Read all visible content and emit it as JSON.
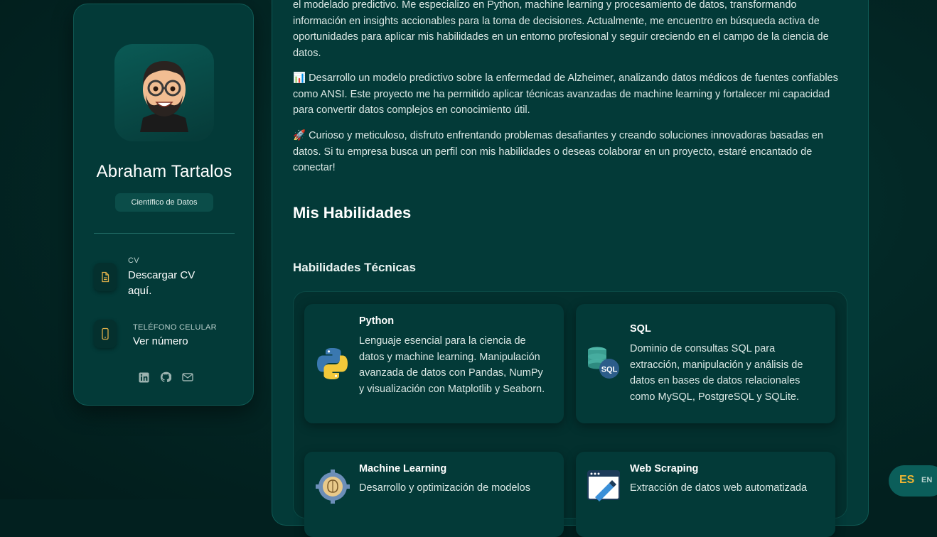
{
  "profile": {
    "name": "Abraham Tartalos",
    "title": "Científico de Datos",
    "contacts": [
      {
        "label": "CV",
        "value": "Descargar CV aquí.",
        "icon": "document-icon"
      },
      {
        "label": "TELÉFONO CELULAR",
        "value": "Ver número",
        "icon": "phone-icon"
      }
    ],
    "socials": [
      "linkedin-icon",
      "github-icon",
      "mail-icon"
    ]
  },
  "about": {
    "paragraphs": [
      "el modelado predictivo. Me especializo en Python, machine learning y procesamiento de datos, transformando información en insights accionables para la toma de decisiones. Actualmente, me encuentro en búsqueda activa de oportunidades para aplicar mis habilidades en un entorno profesional y seguir creciendo en el campo de la ciencia de datos.",
      "📊 Desarrollo un modelo predictivo sobre la enfermedad de Alzheimer, analizando datos médicos de fuentes confiables como ANSI. Este proyecto me ha permitido aplicar técnicas avanzadas de machine learning y fortalecer mi capacidad para convertir datos complejos en conocimiento útil.",
      "🚀 Curioso y meticuloso, disfruto enfrentando problemas desafiantes y creando soluciones innovadoras basadas en datos. Si tu empresa busca un perfil con mis habilidades o deseas colaborar en un proyecto, estaré encantado de conectar!"
    ]
  },
  "skills": {
    "heading": "Mis Habilidades",
    "subheading": "Habilidades Técnicas",
    "items": [
      {
        "name": "Python",
        "description": "Lenguaje esencial para la ciencia de datos y machine learning. Manipulación avanzada de datos con Pandas, NumPy y visualización con Matplotlib y Seaborn.",
        "icon": "python-logo-icon"
      },
      {
        "name": "SQL",
        "description": "Dominio de consultas SQL para extracción, manipulación y análisis de datos en bases de datos relacionales como MySQL, PostgreSQL y SQLite.",
        "icon": "sql-database-icon"
      },
      {
        "name": "Machine Learning",
        "description": "Desarrollo y optimización de modelos",
        "icon": "gear-brain-icon"
      },
      {
        "name": "Web Scraping",
        "description": "Extracción de datos web automatizada",
        "icon": "web-scraping-icon"
      }
    ]
  },
  "language": {
    "active": "ES",
    "other": "EN"
  },
  "colors": {
    "accent": "#f2b632",
    "panel": "#033a38",
    "background": "#02201f"
  }
}
